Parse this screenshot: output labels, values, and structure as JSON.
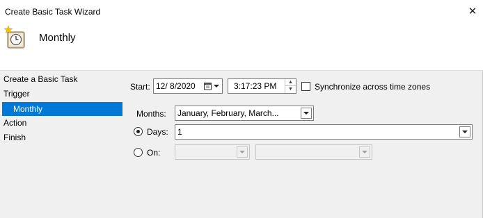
{
  "window": {
    "title": "Create Basic Task Wizard",
    "close_glyph": "✕"
  },
  "header": {
    "title": "Monthly",
    "icon": "task-scheduler-clock-icon"
  },
  "sidebar": {
    "items": [
      {
        "label": "Create a Basic Task"
      },
      {
        "label": "Trigger"
      },
      {
        "label": "Monthly"
      },
      {
        "label": "Action"
      },
      {
        "label": "Finish"
      }
    ],
    "active_index": 2,
    "active_color": "#0078d7"
  },
  "start": {
    "label": "Start:",
    "date_value": "12/  8/2020",
    "time_value": "3:17:23 PM",
    "sync_label": "Synchronize across time zones",
    "sync_checked": false
  },
  "months": {
    "label": "Months:",
    "value": "January, February, March..."
  },
  "days": {
    "label": "Days:",
    "value": "1",
    "selected": true
  },
  "on": {
    "label": "On:",
    "value1": "",
    "value2": "",
    "selected": false
  }
}
